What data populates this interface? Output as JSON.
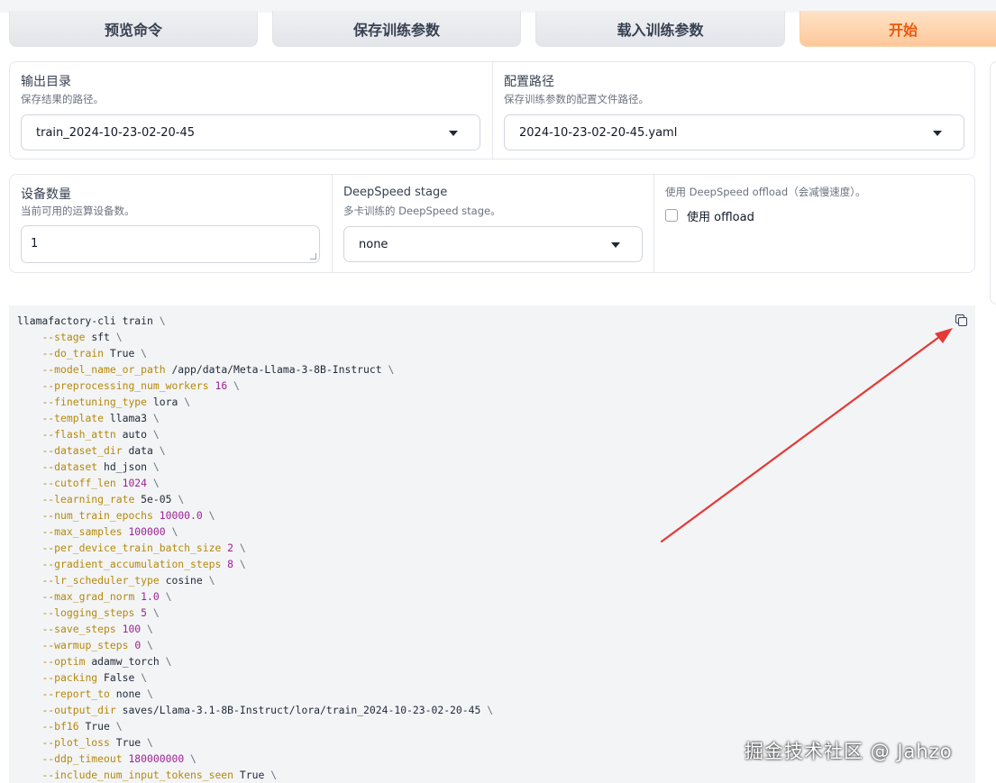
{
  "toolbar": {
    "preview_label": "预览命令",
    "save_label": "保存训练参数",
    "load_label": "载入训练参数",
    "start_label": "开始"
  },
  "output": {
    "label": "输出目录",
    "info": "保存结果的路径。",
    "value": "train_2024-10-23-02-20-45"
  },
  "config": {
    "label": "配置路径",
    "info": "保存训练参数的配置文件路径。",
    "value": "2024-10-23-02-20-45.yaml"
  },
  "devices": {
    "label": "设备数量",
    "info": "当前可用的运算设备数。",
    "value": "1"
  },
  "deepspeed": {
    "label": "DeepSpeed stage",
    "info": "多卡训练的 DeepSpeed stage。",
    "value": "none"
  },
  "offload": {
    "info": "使用 DeepSpeed offload（会减慢速度）。",
    "label": "使用 offload",
    "checked": false
  },
  "command": {
    "lines": [
      {
        "flag": "llamafactory-cli train",
        "value": "",
        "type": "head"
      },
      {
        "flag": "--stage",
        "value": "sft",
        "type": "text"
      },
      {
        "flag": "--do_train",
        "value": "True",
        "type": "text"
      },
      {
        "flag": "--model_name_or_path",
        "value": "/app/data/Meta-Llama-3-8B-Instruct",
        "type": "text"
      },
      {
        "flag": "--preprocessing_num_workers",
        "value": "16",
        "type": "num"
      },
      {
        "flag": "--finetuning_type",
        "value": "lora",
        "type": "text"
      },
      {
        "flag": "--template",
        "value": "llama3",
        "type": "text"
      },
      {
        "flag": "--flash_attn",
        "value": "auto",
        "type": "text"
      },
      {
        "flag": "--dataset_dir",
        "value": "data",
        "type": "text"
      },
      {
        "flag": "--dataset",
        "value": "hd_json",
        "type": "text"
      },
      {
        "flag": "--cutoff_len",
        "value": "1024",
        "type": "num"
      },
      {
        "flag": "--learning_rate",
        "value": "5e-05",
        "type": "text"
      },
      {
        "flag": "--num_train_epochs",
        "value": "10000.0",
        "type": "num"
      },
      {
        "flag": "--max_samples",
        "value": "100000",
        "type": "num"
      },
      {
        "flag": "--per_device_train_batch_size",
        "value": "2",
        "type": "num"
      },
      {
        "flag": "--gradient_accumulation_steps",
        "value": "8",
        "type": "num"
      },
      {
        "flag": "--lr_scheduler_type",
        "value": "cosine",
        "type": "text"
      },
      {
        "flag": "--max_grad_norm",
        "value": "1.0",
        "type": "num"
      },
      {
        "flag": "--logging_steps",
        "value": "5",
        "type": "num"
      },
      {
        "flag": "--save_steps",
        "value": "100",
        "type": "num"
      },
      {
        "flag": "--warmup_steps",
        "value": "0",
        "type": "num"
      },
      {
        "flag": "--optim",
        "value": "adamw_torch",
        "type": "text"
      },
      {
        "flag": "--packing",
        "value": "False",
        "type": "text"
      },
      {
        "flag": "--report_to",
        "value": "none",
        "type": "text"
      },
      {
        "flag": "--output_dir",
        "value": "saves/Llama-3.1-8B-Instruct/lora/train_2024-10-23-02-20-45",
        "type": "text"
      },
      {
        "flag": "--bf16",
        "value": "True",
        "type": "text"
      },
      {
        "flag": "--plot_loss",
        "value": "True",
        "type": "text"
      },
      {
        "flag": "--ddp_timeout",
        "value": "180000000",
        "type": "num"
      },
      {
        "flag": "--include_num_input_tokens_seen",
        "value": "True",
        "type": "text"
      }
    ]
  },
  "annotation": {
    "arrow_color": "#e53935"
  },
  "watermark": "掘金技术社区 @ Jahzo"
}
